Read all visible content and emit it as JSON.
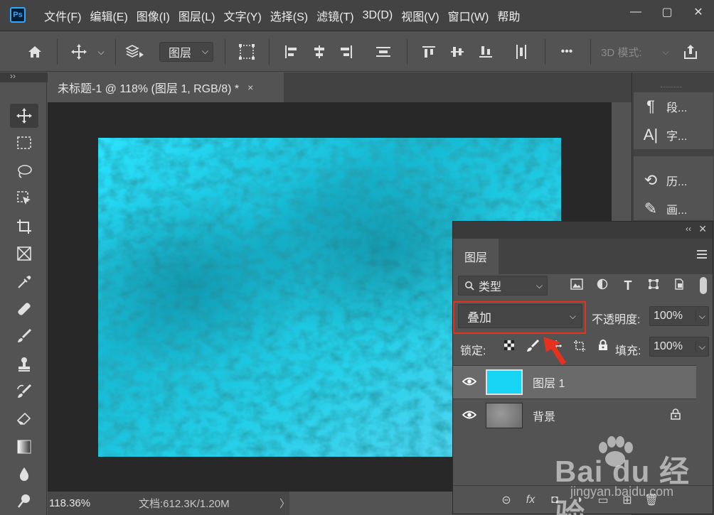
{
  "app": {
    "logo": "Ps"
  },
  "menu": [
    "文件(F)",
    "编辑(E)",
    "图像(I)",
    "图层(L)",
    "文字(Y)",
    "选择(S)",
    "滤镜(T)",
    "3D(D)",
    "视图(V)",
    "窗口(W)",
    "帮助"
  ],
  "window_controls": {
    "minimize": "—",
    "restore": "▢",
    "close": "✕"
  },
  "options_bar": {
    "layer_select": "图层",
    "more": "•••",
    "mode3d": "3D 模式:"
  },
  "document": {
    "tab_title": "未标题-1 @ 118% (图层 1, RGB/8) *",
    "close": "×"
  },
  "status": {
    "zoom": "118.36%",
    "doc_info": "文档:612.3K/1.20M",
    "arrow": "〉"
  },
  "right_dock": {
    "items": [
      {
        "icon": "¶",
        "label": "段..."
      },
      {
        "icon": "A|",
        "label": "字..."
      },
      {
        "icon": "⟲",
        "label": "历..."
      },
      {
        "icon": "✎",
        "label": "画..."
      }
    ],
    "collapse": "‹‹"
  },
  "layers_panel": {
    "tab": "图层",
    "header_collapse": "‹‹",
    "header_close": "✕",
    "filter": {
      "label": "类型",
      "chevron": "⌵"
    },
    "blend_mode": "叠加",
    "opacity_label": "不透明度:",
    "opacity_value": "100%",
    "lock_label": "锁定:",
    "fill_label": "填充:",
    "fill_value": "100%",
    "layers": [
      {
        "name": "图层 1",
        "selected": true,
        "locked": false,
        "thumb_color": "#18d4f4"
      },
      {
        "name": "背景",
        "selected": false,
        "locked": true,
        "thumb_color": "#888888"
      }
    ],
    "footer": {
      "link": "⊝",
      "fx": "fx",
      "mask": "◘",
      "adjust": "◑",
      "group": "▭",
      "new": "⊞",
      "delete": "🗑"
    }
  },
  "watermark": {
    "brand": "Bai du 经验",
    "url": "jingyan.baidu.com"
  },
  "colors": {
    "accent_highlight": "#e8301f",
    "canvas_texture": "#1ec8e8"
  }
}
